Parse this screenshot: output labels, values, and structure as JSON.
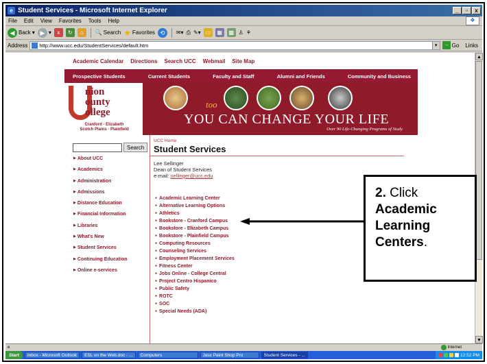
{
  "window": {
    "title": "Student Services - Microsoft Internet Explorer"
  },
  "menubar": {
    "items": [
      "File",
      "Edit",
      "View",
      "Favorites",
      "Tools",
      "Help"
    ]
  },
  "toolbar": {
    "back_label": "Back",
    "search_label": "Search",
    "favorites_label": "Favorites"
  },
  "addressbar": {
    "label": "Address",
    "url": "http://www.ucc.edu/StudentServices/default.htm",
    "go_label": "Go",
    "links_label": "Links"
  },
  "site": {
    "top_links": [
      "Academic Calendar",
      "Directions",
      "Search UCC",
      "Webmail",
      "Site Map"
    ],
    "nav_tabs": [
      "Prospective Students",
      "Current Students",
      "Faculty and Staff",
      "Alumni and Friends",
      "Community and Business"
    ],
    "logo": {
      "line1": "nion",
      "line2": "ounty",
      "line3": "ollege",
      "campus_line1": "Cranford - Elizabeth",
      "campus_line2": "Scotch Plains - Plainfield"
    },
    "banner": {
      "too": "too",
      "tagline": "YOU CAN CHANGE YOUR LIFE",
      "subtitle": "Over 90 Life-Changing Programs of Study"
    },
    "search_button": "Search",
    "sidebar_links": [
      "About UCC",
      "Academics",
      "Administration",
      "Admissions",
      "Distance Education",
      "Financial Information",
      "Libraries",
      "What's New",
      "Student Services",
      "Continuing Education",
      "Online e-services"
    ],
    "breadcrumb": "UCC Home",
    "page_title": "Student Services",
    "contact": {
      "name": "Lee Sellinger",
      "role": "Dean of Student Services",
      "email_label": "e-mail:",
      "email": "sellinger@ucc.edu"
    },
    "service_links": [
      "Academic Learning Center",
      "Alternative Learning Options",
      "Athletics",
      "Bookstore - Cranford Campus",
      "Bookstore - Elizabeth Campus",
      "Bookstore - Plainfield Campus",
      "Computing Resources",
      "Counseling Services",
      "Employment Placement Services",
      "Fitness Center",
      "Jobs Online - College Central",
      "Project Centro Hispanico",
      "Public Safety",
      "ROTC",
      "SOC",
      "Special Needs (ADA)"
    ]
  },
  "callout": {
    "step": "2.",
    "word1": "Click",
    "bold1": "Academic",
    "bold2": "Learning",
    "bold3": "Centers",
    "end": "."
  },
  "statusbar": {
    "zone": "Internet"
  },
  "taskbar": {
    "start": "Start",
    "tasks": [
      "Inbox - Microsoft Outlook",
      "ESL on the Web.doc - ...",
      "Computers",
      "Jasc Paint Shop Pro",
      "Student Services - ..."
    ],
    "clock": "12:52 PM"
  }
}
